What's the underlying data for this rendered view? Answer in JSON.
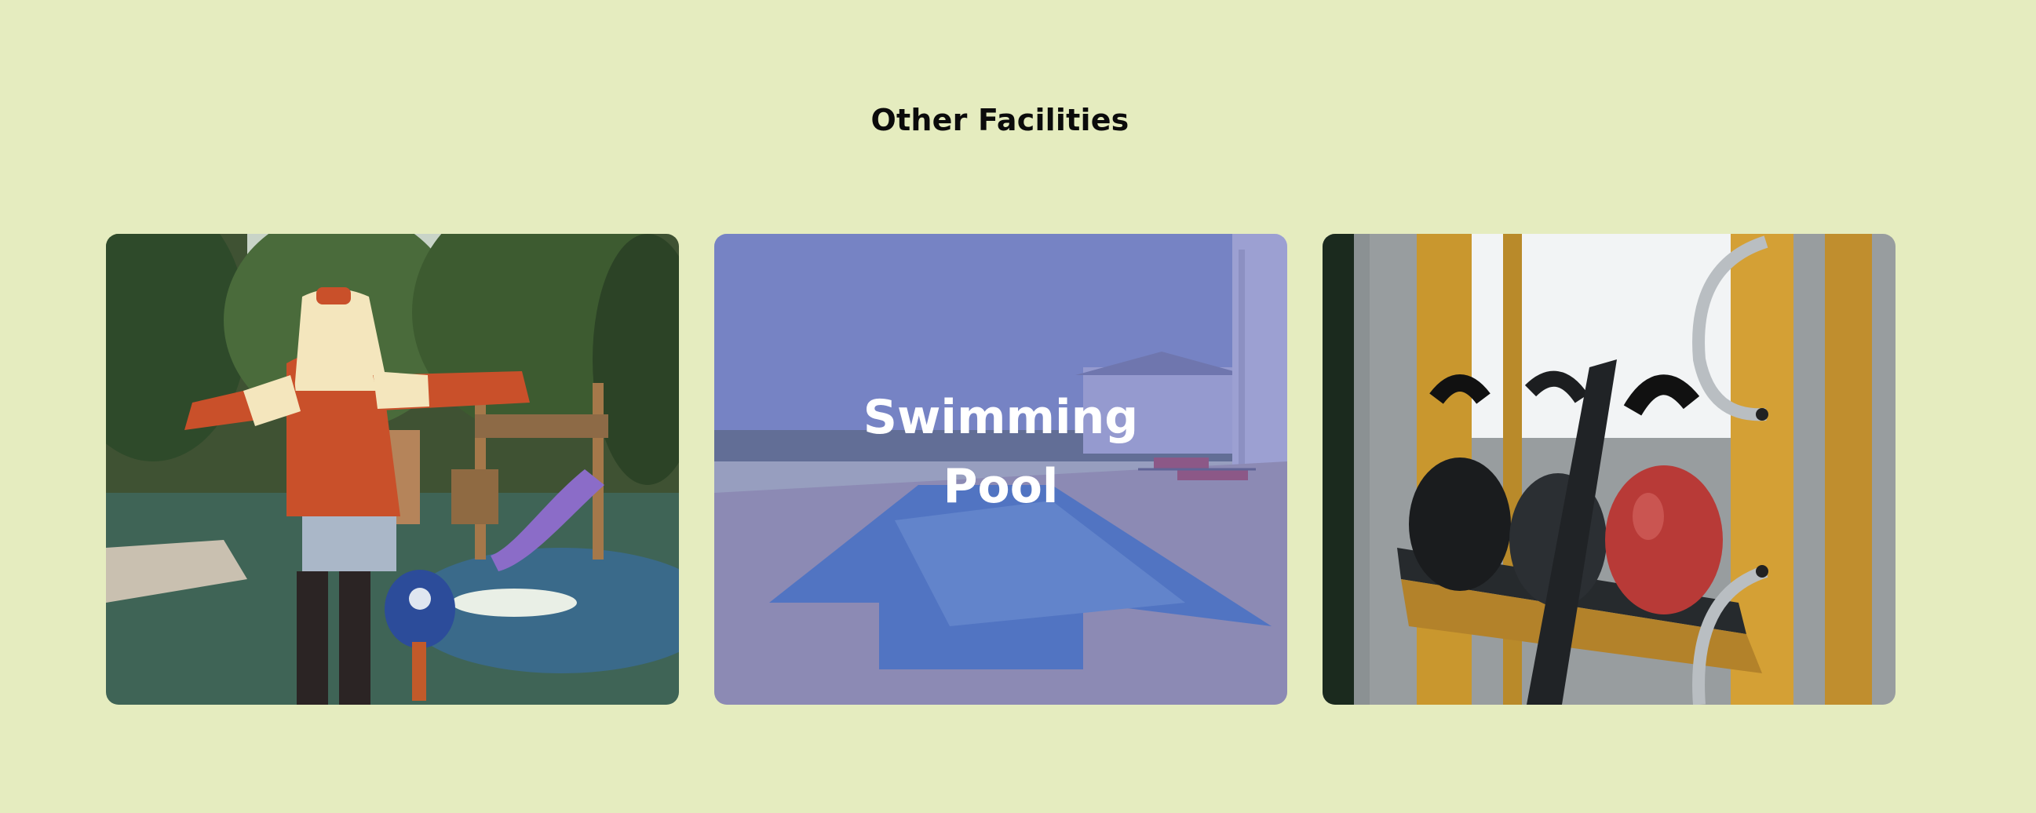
{
  "section": {
    "title": "Other Facilities"
  },
  "cards": [
    {
      "name": "Playground",
      "image_subject": "children's playground with a person in an oversized sweater",
      "label_visible": false
    },
    {
      "name": "Swimming Pool",
      "label_lines": [
        "Swimming",
        "Pool"
      ],
      "image_subject": "outdoor swimming pool with sun loungers",
      "label_visible": true,
      "overlay_color": "#686ebe"
    },
    {
      "name": "Gym",
      "image_subject": "kettlebells on a gym rack",
      "label_visible": false
    }
  ],
  "colors": {
    "background": "#e5ecbf",
    "title_text": "#0b0b0b",
    "card_label_text": "#ffffff"
  }
}
